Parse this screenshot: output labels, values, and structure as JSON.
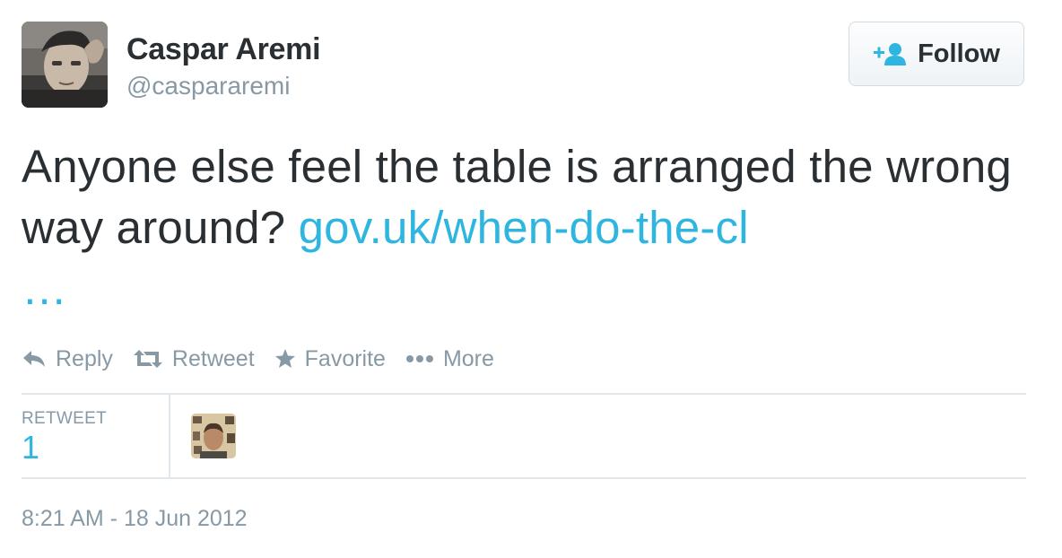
{
  "user": {
    "display_name": "Caspar Aremi",
    "screen_name": "@caspararemi"
  },
  "follow_button": {
    "label": "Follow",
    "icon": "add-user-icon"
  },
  "tweet": {
    "text": "Anyone else feel the table is arranged the wrong way around?",
    "link_text": "gov.uk/when-do-the-cl",
    "link_ellipsis": "…"
  },
  "actions": [
    {
      "label": "Reply",
      "icon": "reply-icon"
    },
    {
      "label": "Retweet",
      "icon": "retweet-icon"
    },
    {
      "label": "Favorite",
      "icon": "star-icon"
    },
    {
      "label": "More",
      "icon": "more-dots-icon"
    }
  ],
  "stats": {
    "retweets_label": "RETWEET",
    "retweets_count": "1"
  },
  "timestamp": "8:21 AM - 18 Jun 2012",
  "colors": {
    "link": "#2fb6e0",
    "muted": "#8899a6",
    "text": "#292f33",
    "border": "#e1e8ed"
  }
}
